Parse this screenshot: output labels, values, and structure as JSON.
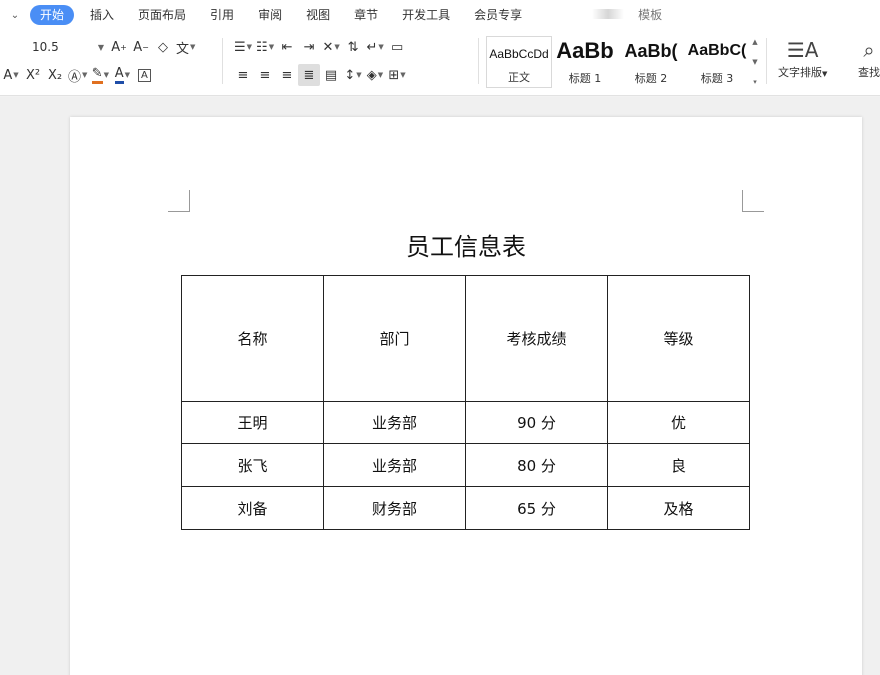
{
  "menu": {
    "tabs": [
      "开始",
      "插入",
      "页面布局",
      "引用",
      "审阅",
      "视图",
      "章节",
      "开发工具",
      "会员专享"
    ],
    "active_tab": "开始",
    "template_label": "模板"
  },
  "ribbon": {
    "font_size": "10.5",
    "styles": [
      {
        "sample": "AaBbCcDd",
        "name": "正文"
      },
      {
        "sample": "AaBb",
        "name": "标题 1"
      },
      {
        "sample": "AaBb(",
        "name": "标题 2"
      },
      {
        "sample": "AaBbC(",
        "name": "标题 3"
      }
    ],
    "text_layout_label": "文字排版",
    "find_label": "查找"
  },
  "document": {
    "title": "员工信息表",
    "table": {
      "headers": [
        "名称",
        "部门",
        "考核成绩",
        "等级"
      ],
      "rows": [
        [
          "王明",
          "业务部",
          "90 分",
          "优"
        ],
        [
          "张飞",
          "业务部",
          "80 分",
          "良"
        ],
        [
          "刘备",
          "财务部",
          "65 分",
          "及格"
        ]
      ]
    }
  },
  "colors": {
    "accent": "#4a8ef5",
    "highlight": "#e07020",
    "font_color": "#1f4ea8"
  }
}
